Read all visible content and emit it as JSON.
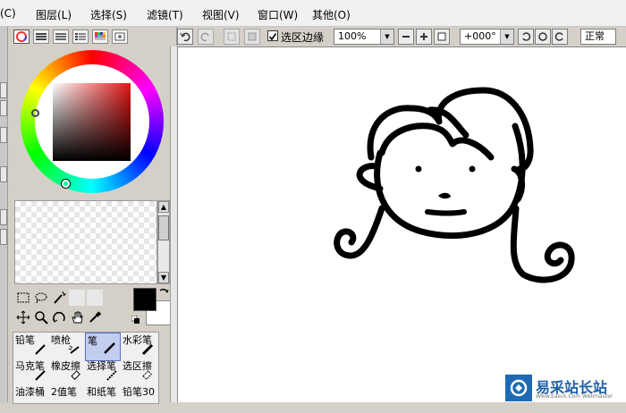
{
  "menubar": {
    "items": [
      {
        "label": "(C)"
      },
      {
        "label": "图层(L)"
      },
      {
        "label": "选择(S)"
      },
      {
        "label": "滤镜(T)"
      },
      {
        "label": "视图(V)"
      },
      {
        "label": "窗口(W)"
      },
      {
        "label": "其他(O)"
      }
    ]
  },
  "color_panel": {
    "foreground_color": "#000000",
    "background_color": "#ffffff",
    "hue_color": "#e01414"
  },
  "brushes": [
    {
      "label": "铅笔"
    },
    {
      "label": "喷枪"
    },
    {
      "label": "笔",
      "selected": true
    },
    {
      "label": "水彩笔"
    },
    {
      "label": "马克笔"
    },
    {
      "label": "橡皮擦"
    },
    {
      "label": "选择笔"
    },
    {
      "label": "选区擦"
    },
    {
      "label": "油漆桶"
    },
    {
      "label": "2值笔"
    },
    {
      "label": "和纸笔"
    },
    {
      "label": "铅笔30"
    }
  ],
  "toolbar": {
    "selection_edge_label": "选区边缘",
    "selection_edge_checked": true,
    "zoom": "100%",
    "rotation": "+000°",
    "mode": "正常"
  },
  "watermark": {
    "title": "易采站长站",
    "url": "Www.Easck.Com Webmaster"
  }
}
